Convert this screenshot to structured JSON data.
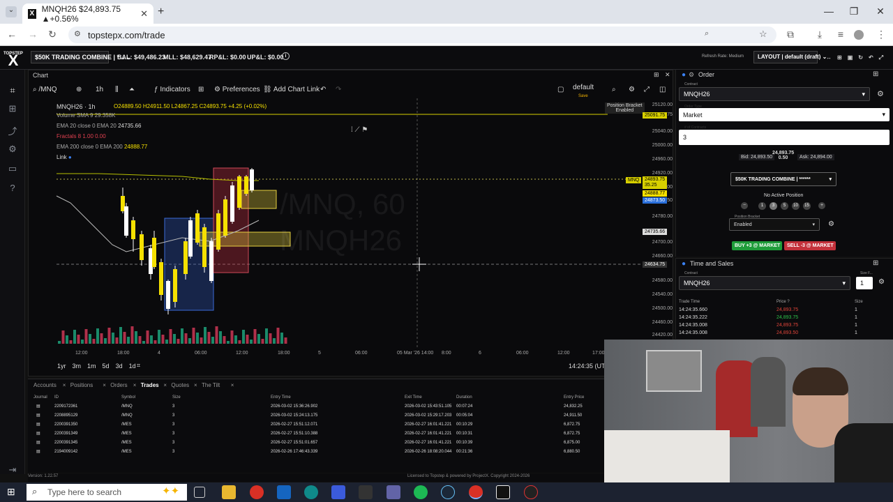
{
  "browser": {
    "tab_title": "MNQH26 $24,893.75 ▲+0.56%",
    "url": "topstepx.com/trade"
  },
  "topbar": {
    "logo": "X",
    "logo_sub": "TOPSTEP",
    "account": "$50K TRADING COMBINE | *...",
    "bal": "BAL: $49,486.23",
    "mll": "MLL: $48,629.47",
    "rpl": "RP&L: $0.00",
    "upl": "UP&L: $0.00",
    "refresh": "Refresh Rate: Medium",
    "layout": "LAYOUT | default (draft)"
  },
  "chart": {
    "panel_title": "Chart",
    "symbol_search": "/MNQ",
    "interval": "1h",
    "indicators": "Indicators",
    "preferences": "Preferences",
    "add_link": "Add Chart Link",
    "template": "default",
    "template_sub": "Save",
    "legend_symbol": "MNQH26 · 1h",
    "ohlc": "O24889.50 H24911.50 L24867.25 C24893.75 +4.25 (+0.02%)",
    "ind_volume": "Volume SMA 9  29.358K",
    "ind_ema20_label": "EMA 20 close 0 EMA 20",
    "ind_ema20_value": "24735.66",
    "ind_fractals": "Fractals 8  1.00  0.00",
    "ind_ema200_label": "EMA 200 close 0 EMA 200",
    "ind_ema200_value": "24888.77",
    "link": "Link",
    "watermark_line1": "/MNQ, 60",
    "watermark_line2": "MNQH26",
    "position_bracket": "Position Bracket",
    "position_bracket_state": "Enabled",
    "price_levels": [
      "25120.00",
      "25091.75",
      "25040.00",
      "25000.00",
      "24960.00",
      "24920.00",
      "24880.00",
      "24873.50",
      "24780.00",
      "24700.00",
      "24660.00",
      "24580.00",
      "24540.00",
      "24500.00",
      "24460.00",
      "24420.00"
    ],
    "tag_last": "24893.75",
    "tag_last_sub": "35.25",
    "tag_ema200": "24888.77",
    "tag_bid": "24873.50",
    "tag_ema20": "24735.66",
    "tag_cursor": "24634.75",
    "tag_top": "25091.75",
    "tag_sym": "MNQ",
    "time_labels": [
      "12:00",
      "18:00",
      "4",
      "06:00",
      "12:00",
      "18:00",
      "5",
      "06:00",
      "05 Mar '26  14:00",
      "8:00",
      "6",
      "06:00",
      "12:00",
      "17:00"
    ],
    "ranges": [
      "1yr",
      "3m",
      "1m",
      "5d",
      "3d",
      "1d"
    ],
    "clock": "14:24:35 (UTC"
  },
  "order": {
    "title": "Order",
    "contract_label": "Contract",
    "contract": "MNQH26",
    "order_type_label": "Order Type",
    "order_type": "Market",
    "contracts_label": "# of Contracts",
    "contracts": "3",
    "bid": "Bid: 24,893.50",
    "last": "24,893.75",
    "spread": "0.50",
    "ask": "Ask: 24,894.00",
    "account": "$50K TRADING COMBINE | ******",
    "no_position": "No Active Position",
    "qty_buttons": [
      "1",
      "3",
      "5",
      "10",
      "15"
    ],
    "bracket_label": "Position Bracket",
    "bracket": "Enabled",
    "buy": "BUY +3 @ MARKET",
    "sell": "SELL -3 @ MARKET"
  },
  "ts": {
    "title": "Time and Sales",
    "contract_label": "Contract",
    "contract": "MNQH26",
    "size_label": "Size F...",
    "size": "1",
    "headers": [
      "Trade Time",
      "Price",
      "Size"
    ],
    "rows": [
      {
        "time": "14:24:35.660",
        "price": "24,893.75",
        "size": "1",
        "color": "#e0453a"
      },
      {
        "time": "14:24:35.222",
        "price": "24,893.75",
        "size": "1",
        "color": "#2ec24a"
      },
      {
        "time": "14:24:35.008",
        "price": "24,893.75",
        "size": "1",
        "color": "#e0453a"
      },
      {
        "time": "14:24:35.008",
        "price": "24,893.50",
        "size": "1",
        "color": "#e0453a"
      }
    ]
  },
  "bottom": {
    "tabs": [
      "Accounts",
      "Positions",
      "Orders",
      "Trades",
      "Quotes",
      "The Tilt"
    ],
    "headers": [
      "Journal",
      "ID",
      "Symbol",
      "Size",
      "Entry Time",
      "Exit Time",
      "Duration",
      "Entry Price"
    ],
    "rows": [
      {
        "id": "2209172361",
        "symbol": "/MNQ",
        "size": "3",
        "entry": "2026-03-02 15:36:26.902",
        "exit": "2026-03-02 15:43:51.105",
        "dur": "00:07:24",
        "price": "24,832.25"
      },
      {
        "id": "2208895129",
        "symbol": "/MNQ",
        "size": "3",
        "entry": "2026-03-02 15:24:13.175",
        "exit": "2026-03-02 15:29:17.203",
        "dur": "00:05:04",
        "price": "24,911.50"
      },
      {
        "id": "2200391350",
        "symbol": "/MES",
        "size": "3",
        "entry": "2026-02-27 15:51:12.071",
        "exit": "2026-02-27 16:01:41.221",
        "dur": "00:10:29",
        "price": "6,872.75"
      },
      {
        "id": "2200391349",
        "symbol": "/MES",
        "size": "3",
        "entry": "2026-02-27 15:51:10.388",
        "exit": "2026-02-27 16:01:41.221",
        "dur": "00:10:31",
        "price": "6,872.75"
      },
      {
        "id": "2200391345",
        "symbol": "/MES",
        "size": "3",
        "entry": "2026-02-27 15:51:01.657",
        "exit": "2026-02-27 16:01:41.221",
        "dur": "00:10:39",
        "price": "6,875.00"
      },
      {
        "id": "2194009142",
        "symbol": "/MES",
        "size": "3",
        "entry": "2026-02-26 17:46:43.339",
        "exit": "2026-02-26 18:08:20.044",
        "dur": "00:21:36",
        "price": "6,880.50"
      }
    ],
    "version": "Version: 1.22.57",
    "license": "Licensed to Topstep & powered by ProjectX. Copyright 2024-2026"
  },
  "taskbar": {
    "search": "Type here to search"
  }
}
